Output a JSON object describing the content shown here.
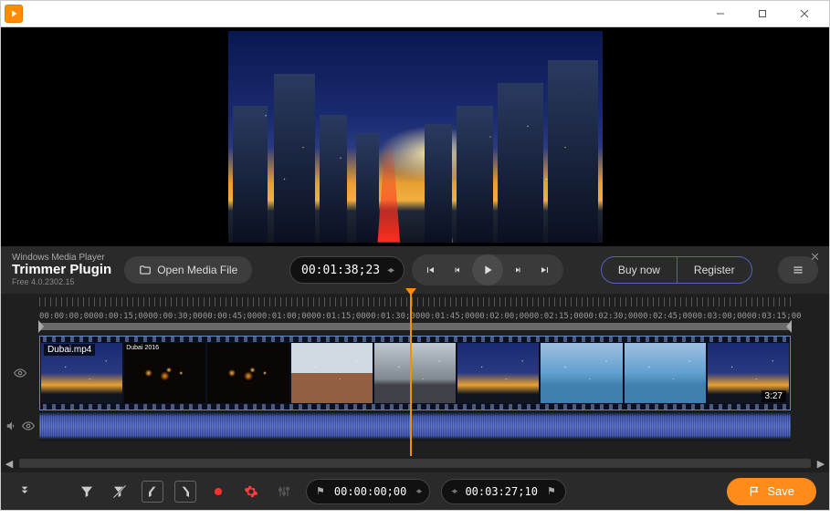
{
  "titlebar": {},
  "toolbar": {
    "subtitle": "Windows Media Player",
    "title": "Trimmer Plugin",
    "version": "Free 4.0.2302.15",
    "open_label": "Open Media File",
    "timecode": "00:01:38;23",
    "buy_label": "Buy now",
    "register_label": "Register"
  },
  "ruler_marks": [
    "00:00:00;00",
    "00:00:15;00",
    "00:00:30;00",
    "00:00:45;00",
    "00:01:00;00",
    "00:01:15;00",
    "00:01:30;00",
    "00:01:45;00",
    "00:02:00;00",
    "00:02:15;00",
    "00:02:30;00",
    "00:02:45;00",
    "00:03:00;00",
    "00:03:15;00"
  ],
  "clip": {
    "name": "Dubai.mp4",
    "duration": "3:27",
    "thumb_label": "Dubai 2016"
  },
  "bottom": {
    "in_time": "00:00:00;00",
    "out_time": "00:03:27;10",
    "save_label": "Save"
  }
}
